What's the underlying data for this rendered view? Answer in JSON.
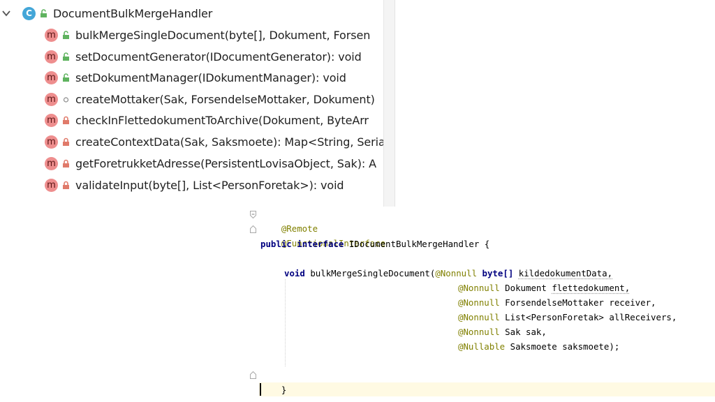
{
  "structure": {
    "root": {
      "label": "DocumentBulkMergeHandler",
      "badge": "C"
    },
    "methods": [
      {
        "label": "bulkMergeSingleDocument(byte[], Dokument, Forsen",
        "badge": "m",
        "visibility": "public"
      },
      {
        "label": "setDocumentGenerator(IDocumentGenerator): void",
        "badge": "m",
        "visibility": "public"
      },
      {
        "label": "setDokumentManager(IDokumentManager): void",
        "badge": "m",
        "visibility": "public"
      },
      {
        "label": "createMottaker(Sak, ForsendelseMottaker, Dokument)",
        "badge": "m",
        "visibility": "package"
      },
      {
        "label": "checkInFlettedokumentToArchive(Dokument, ByteArr",
        "badge": "m",
        "visibility": "private"
      },
      {
        "label": "createContextData(Sak, Saksmoete): Map<String, Seria",
        "badge": "m",
        "visibility": "private"
      },
      {
        "label": "getForetrukketAdresse(PersistentLovisaObject, Sak): A",
        "badge": "m",
        "visibility": "private"
      },
      {
        "label": "validateInput(byte[], List<PersonForetak>): void",
        "badge": "m",
        "visibility": "private"
      }
    ]
  },
  "editor": {
    "ann_remote": "@Remote",
    "ann_functional": "@FunctionalInterface",
    "decl": {
      "kw_public": "public",
      "kw_interface": "interface",
      "name": "IDocumentBulkMergeHandler {"
    },
    "method": {
      "kw_void": "void",
      "name": "bulkMergeSingleDocument(",
      "params": [
        {
          "ann": "@Nonnull",
          "type": "byte[]",
          "name": "kildedokumentData,",
          "type_is_keyword": true
        },
        {
          "ann": "@Nonnull",
          "type": "Dokument",
          "name": "flettedokument,",
          "type_is_keyword": false
        },
        {
          "ann": "@Nonnull",
          "type": "ForsendelseMottaker",
          "name": "receiver,",
          "type_is_keyword": false
        },
        {
          "ann": "@Nonnull",
          "type": "List<PersonForetak>",
          "name": "allReceivers,",
          "type_is_keyword": false
        },
        {
          "ann": "@Nonnull",
          "type": "Sak",
          "name": "sak,",
          "type_is_keyword": false
        },
        {
          "ann": "@Nullable",
          "type": "Saksmoete",
          "name": "saksmoete);",
          "type_is_keyword": false
        }
      ]
    },
    "closing_brace": "}"
  },
  "colors": {
    "class_badge": "#43a6d8",
    "method_badge": "#ee8e8e",
    "keyword": "#000080",
    "annotation": "#808000",
    "current_line": "#fffae3"
  }
}
